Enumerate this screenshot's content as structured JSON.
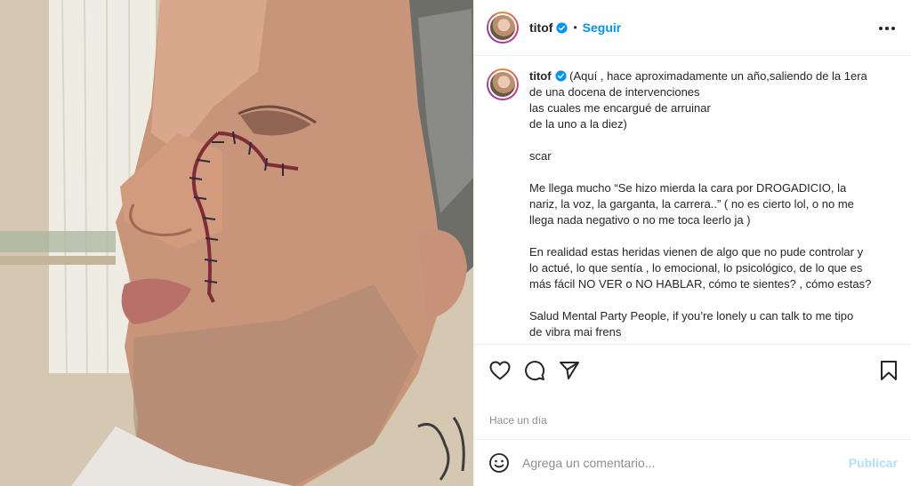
{
  "post": {
    "username": "titof",
    "separator": "•",
    "follow_label": "Seguir",
    "caption_lines": [
      "(Aquí , hace aproximadamente un año,saliendo de la 1era",
      "de una docena de intervenciones",
      "las cuales me encargué de arruinar",
      "de la uno a la diez)",
      "",
      "scar",
      "",
      "Me llega mucho “Se hizo mierda la cara por DROGADICIO, la",
      "nariz, la voz, la garganta, la carrera..” ( no es cierto lol, o no me",
      "llega nada negativo o no me toca leerlo ja )",
      "",
      "En realidad estas heridas vienen de algo que no pude controlar y",
      "lo actué, lo que sentía , lo emocional, lo psicológico, de lo que es",
      "más fácil NO VER o NO HABLAR, cómo te sientes? , cómo estas?",
      "",
      "Salud Mental Party People, if you’re lonely u can talk to me tipo",
      "de vibra mai frens"
    ],
    "timestamp": "Hace un día",
    "comment_placeholder": "Agrega un comentario...",
    "publish_label": "Publicar"
  },
  "icons": {
    "verified": "verified-badge-icon",
    "more": "more-options-icon",
    "like": "heart-icon",
    "comment": "comment-bubble-icon",
    "share": "paper-plane-icon",
    "save": "bookmark-icon",
    "emoji": "emoji-icon"
  },
  "colors": {
    "accent": "#0095f6",
    "publish_disabled": "#b2dffc",
    "text": "#262626",
    "muted": "#8e8e8e"
  }
}
